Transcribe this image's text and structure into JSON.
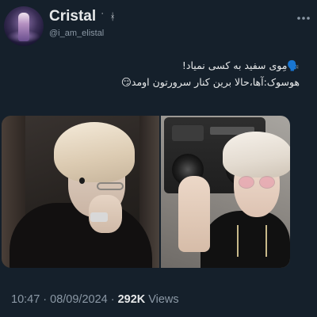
{
  "author": {
    "display_name": "Cristal",
    "name_decoration": "ˈ ᚼ",
    "handle": "@i_am_elistal"
  },
  "tweet": {
    "line1": "🗣️مِوی سفید به کسی نمیاد!",
    "line2": "هوسوک:آها،حالا برین کنار سرورتون اومد😏"
  },
  "meta": {
    "time": "10:47",
    "date": "08/09/2024",
    "separator": "·",
    "views_count": "292K",
    "views_label": "Views"
  },
  "icons": {
    "more": "more-horizontal-icon"
  },
  "colors": {
    "background": "#15202b",
    "text_primary": "#e7e9ea",
    "text_secondary": "#8b98a5"
  }
}
